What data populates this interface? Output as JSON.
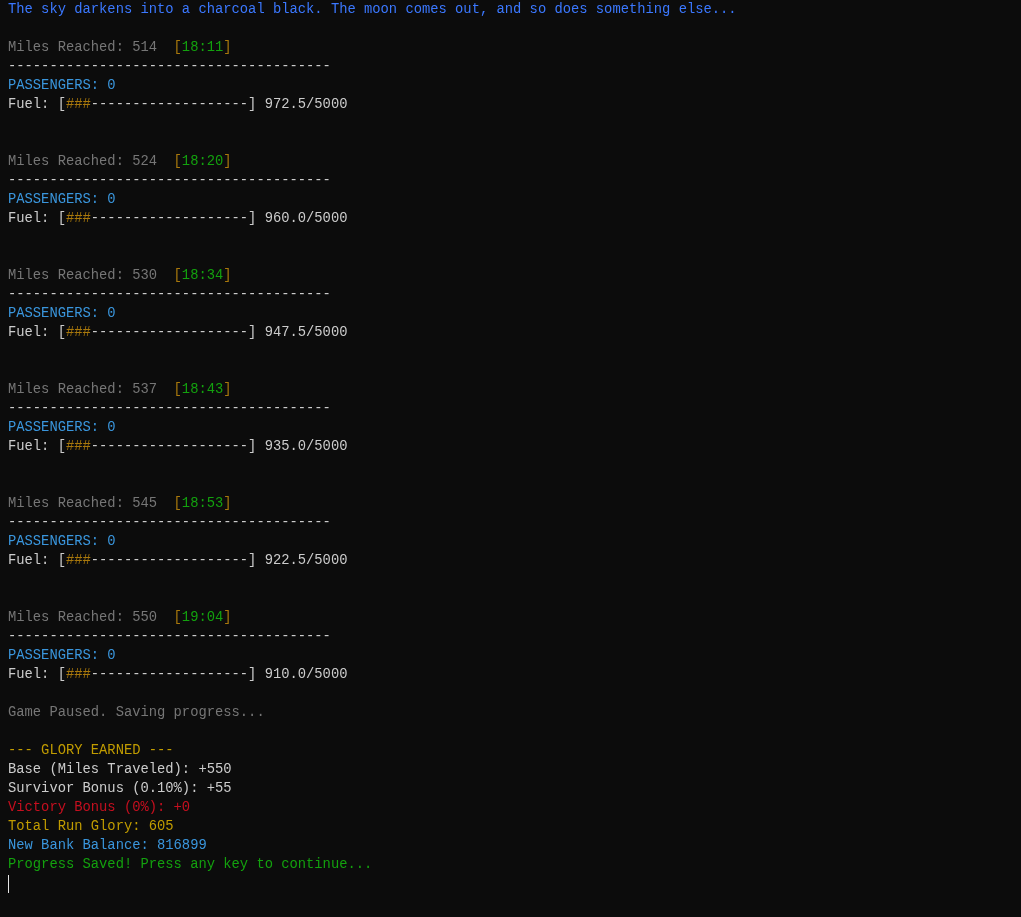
{
  "intro": "The sky darkens into a charcoal black. The moon comes out, and so does something else...",
  "checkpoints": [
    {
      "miles": "Miles Reached: 514",
      "time": {
        "open": "[",
        "value": "18:11",
        "close": "]"
      },
      "divider": "---------------------------------------",
      "passengers": "PASSENGERS: 0",
      "fuel": {
        "label": "Fuel:",
        "open": "[",
        "filled": "###",
        "empty": "-------------------",
        "close": "]",
        "reading": "972.5/5000"
      }
    },
    {
      "miles": "Miles Reached: 524",
      "time": {
        "open": "[",
        "value": "18:20",
        "close": "]"
      },
      "divider": "---------------------------------------",
      "passengers": "PASSENGERS: 0",
      "fuel": {
        "label": "Fuel:",
        "open": "[",
        "filled": "###",
        "empty": "-------------------",
        "close": "]",
        "reading": "960.0/5000"
      }
    },
    {
      "miles": "Miles Reached: 530",
      "time": {
        "open": "[",
        "value": "18:34",
        "close": "]"
      },
      "divider": "---------------------------------------",
      "passengers": "PASSENGERS: 0",
      "fuel": {
        "label": "Fuel:",
        "open": "[",
        "filled": "###",
        "empty": "-------------------",
        "close": "]",
        "reading": "947.5/5000"
      }
    },
    {
      "miles": "Miles Reached: 537",
      "time": {
        "open": "[",
        "value": "18:43",
        "close": "]"
      },
      "divider": "---------------------------------------",
      "passengers": "PASSENGERS: 0",
      "fuel": {
        "label": "Fuel:",
        "open": "[",
        "filled": "###",
        "empty": "-------------------",
        "close": "]",
        "reading": "935.0/5000"
      }
    },
    {
      "miles": "Miles Reached: 545",
      "time": {
        "open": "[",
        "value": "18:53",
        "close": "]"
      },
      "divider": "---------------------------------------",
      "passengers": "PASSENGERS: 0",
      "fuel": {
        "label": "Fuel:",
        "open": "[",
        "filled": "###",
        "empty": "-------------------",
        "close": "]",
        "reading": "922.5/5000"
      }
    },
    {
      "miles": "Miles Reached: 550",
      "time": {
        "open": "[",
        "value": "19:04",
        "close": "]"
      },
      "divider": "---------------------------------------",
      "passengers": "PASSENGERS: 0",
      "fuel": {
        "label": "Fuel:",
        "open": "[",
        "filled": "###",
        "empty": "-------------------",
        "close": "]",
        "reading": "910.0/5000"
      }
    }
  ],
  "status": "Game Paused. Saving progress...",
  "summary": [
    {
      "kind": "heading",
      "text": "--- GLORY EARNED ---"
    },
    {
      "kind": "plain",
      "text": "Base (Miles Traveled): +550"
    },
    {
      "kind": "plain",
      "text": "Survivor Bonus (0.10%): +55"
    },
    {
      "kind": "penalty",
      "text": "Victory Bonus (0%): +0"
    },
    {
      "kind": "total",
      "text": "Total Run Glory: 605"
    },
    {
      "kind": "balance",
      "text": "New Bank Balance: 816899"
    },
    {
      "kind": "success",
      "text": "Progress Saved! Press any key to continue..."
    }
  ]
}
